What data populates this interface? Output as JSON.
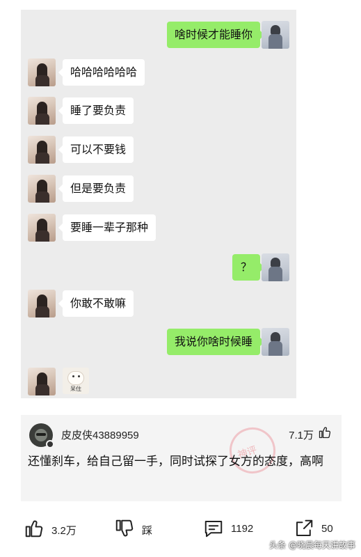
{
  "chat": {
    "messages": [
      {
        "from": "me",
        "text": "啥时候才能睡你"
      },
      {
        "from": "her",
        "text": "哈哈哈哈哈哈"
      },
      {
        "from": "her",
        "text": "睡了要负责"
      },
      {
        "from": "her",
        "text": "可以不要钱"
      },
      {
        "from": "her",
        "text": "但是要负责"
      },
      {
        "from": "her",
        "text": "要睡一辈子那种"
      },
      {
        "from": "me",
        "text": "？"
      },
      {
        "from": "her",
        "text": "你敢不敢嘛"
      },
      {
        "from": "me",
        "text": "我说你啥时候睡"
      },
      {
        "from": "her",
        "sticker_caption": "呆住"
      }
    ],
    "colors": {
      "background": "#ececec",
      "my_bubble": "#95ec69",
      "their_bubble": "#ffffff"
    }
  },
  "comment": {
    "username": "皮皮侠43889959",
    "likes": "7.1万",
    "text": "还懂刹车，给自己留一手，同时试探了女方的态度，高啊",
    "stamp_text": "神评",
    "like_icon": "thumb-up-icon"
  },
  "actions": {
    "like": {
      "icon": "thumb-up-icon",
      "label": "3.2万"
    },
    "dislike": {
      "icon": "thumb-down-icon",
      "label": "踩"
    },
    "comment": {
      "icon": "comment-icon",
      "label": "1192"
    },
    "share": {
      "icon": "share-icon",
      "label": "50"
    }
  },
  "credit": "头条 @晓晨每天讲故事"
}
